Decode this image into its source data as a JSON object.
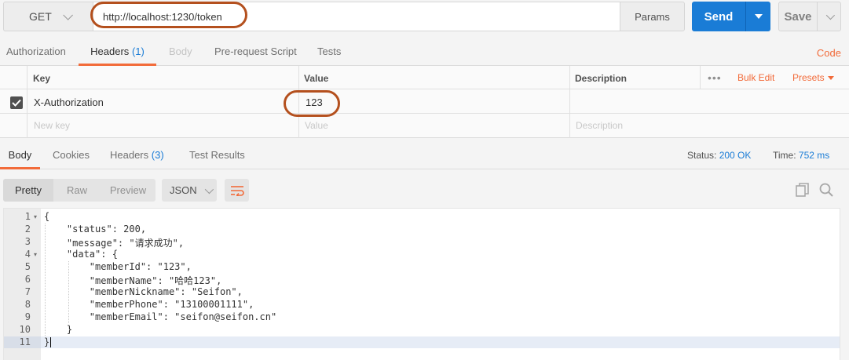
{
  "request": {
    "method": "GET",
    "url": "http://localhost:1230/token",
    "params_label": "Params",
    "send_label": "Send",
    "save_label": "Save"
  },
  "request_tabs": [
    {
      "label": "Authorization"
    },
    {
      "label": "Headers",
      "count": "(1)"
    },
    {
      "label": "Body"
    },
    {
      "label": "Pre-request Script"
    },
    {
      "label": "Tests"
    }
  ],
  "code_link": "Code",
  "headers_table": {
    "columns": [
      "Key",
      "Value",
      "Description"
    ],
    "more": "•••",
    "bulk_edit": "Bulk Edit",
    "presets": "Presets",
    "rows": [
      {
        "key": "X-Authorization",
        "value": "123",
        "description": "",
        "checked": true
      }
    ],
    "new_row": {
      "key_placeholder": "New key",
      "value_placeholder": "Value",
      "description_placeholder": "Description"
    }
  },
  "response_tabs": [
    {
      "label": "Body"
    },
    {
      "label": "Cookies"
    },
    {
      "label": "Headers",
      "count": "(3)"
    },
    {
      "label": "Test Results"
    }
  ],
  "response_status": {
    "status_label": "Status:",
    "status_value": "200 OK",
    "time_label": "Time:",
    "time_value": "752 ms"
  },
  "view_modes": [
    "Pretty",
    "Raw",
    "Preview"
  ],
  "format": "JSON",
  "icons": {
    "wrap": "wrap-lines-icon",
    "copy": "copy-icon",
    "search": "search-icon",
    "check": "checkmark-icon"
  },
  "colors": {
    "accent": "#f26b3a",
    "send": "#1a7cd6",
    "annotation": "#b4501e"
  },
  "code_lines": [
    {
      "n": "1",
      "text": "{"
    },
    {
      "n": "2",
      "text": "    \"status\": 200,"
    },
    {
      "n": "3",
      "text": "    \"message\": \"请求成功\","
    },
    {
      "n": "4",
      "text": "    \"data\": {"
    },
    {
      "n": "5",
      "text": "        \"memberId\": \"123\","
    },
    {
      "n": "6",
      "text": "        \"memberName\": \"哈哈123\","
    },
    {
      "n": "7",
      "text": "        \"memberNickname\": \"Seifon\","
    },
    {
      "n": "8",
      "text": "        \"memberPhone\": \"13100001111\","
    },
    {
      "n": "9",
      "text": "        \"memberEmail\": \"seifon@seifon.cn\""
    },
    {
      "n": "10",
      "text": "    }"
    },
    {
      "n": "11",
      "text": "}"
    }
  ]
}
